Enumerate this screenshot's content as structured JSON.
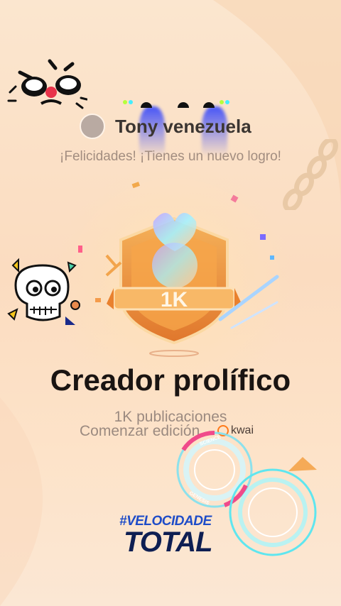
{
  "header": {
    "username": "Tony venezuela",
    "congrats": "¡Felicidades! ¡Tienes un nuevo logro!"
  },
  "badge": {
    "label": "1K"
  },
  "achievement": {
    "title": "Creador prolífico",
    "subtitle": "1K publicaciones",
    "action": "Comenzar edición"
  },
  "watermark": {
    "kwai": "kwai"
  },
  "overlay": {
    "brand_line1": "#VELOCIDADE",
    "brand_line2": "TOTAL",
    "ring_text_1": "SCIENCE",
    "ring_text_2": "GENESIS"
  }
}
